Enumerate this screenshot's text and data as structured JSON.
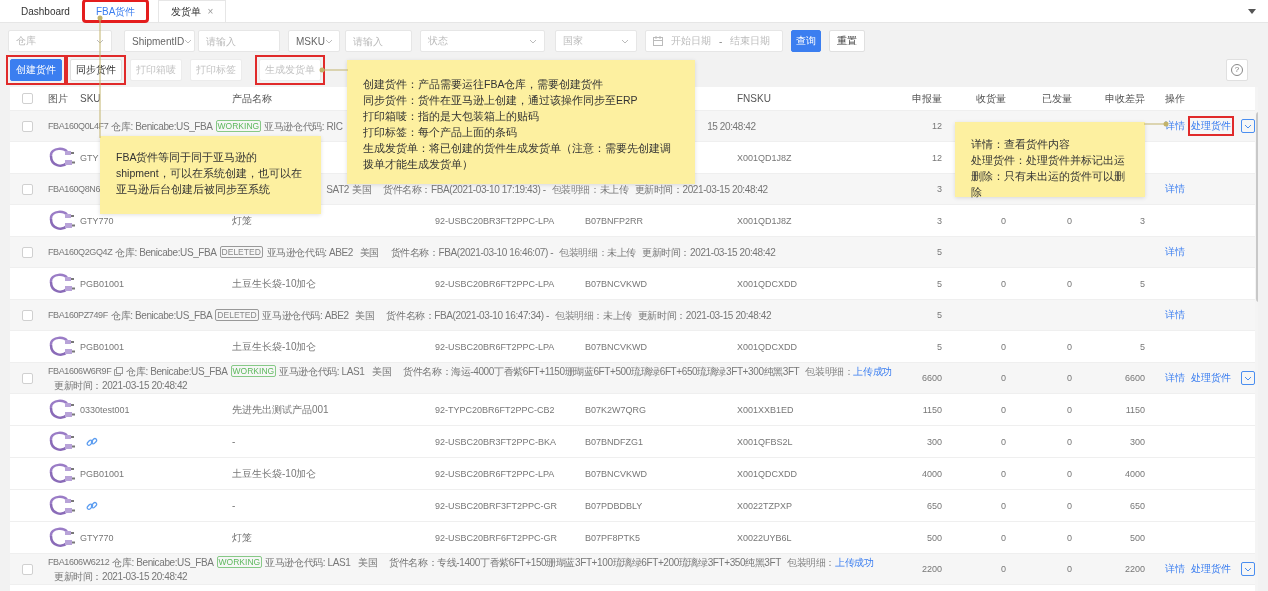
{
  "tabs": [
    {
      "label": "Dashboard",
      "selected": false,
      "highlighted": false
    },
    {
      "label": "FBA货件",
      "selected": true,
      "highlighted": true
    },
    {
      "label": "发货单",
      "selected": false,
      "highlighted": false,
      "close": "×"
    }
  ],
  "filters": [
    {
      "kind": "select",
      "placeholder": "仓库"
    },
    {
      "kind": "select",
      "value": "ShipmentID"
    },
    {
      "kind": "input",
      "placeholder": "请输入"
    },
    {
      "kind": "select",
      "value": "MSKU"
    },
    {
      "kind": "input",
      "placeholder": "请输入"
    },
    {
      "kind": "select",
      "placeholder": "状态"
    },
    {
      "kind": "select",
      "placeholder": "国家"
    },
    {
      "kind": "daterange",
      "start_placeholder": "开始日期",
      "separator": "-",
      "end_placeholder": "结束日期"
    },
    {
      "kind": "button",
      "label": "查询",
      "primary": true
    },
    {
      "kind": "button",
      "label": "重置",
      "primary": false
    }
  ],
  "toolbar": {
    "buttons": [
      {
        "label": "创建货件",
        "primary": true,
        "disabled": false,
        "highlighted": true
      },
      {
        "label": "同步货件",
        "primary": false,
        "disabled": false,
        "highlighted": true
      },
      {
        "label": "打印箱唛",
        "primary": false,
        "disabled": true,
        "highlighted": false
      },
      {
        "label": "打印标签",
        "primary": false,
        "disabled": true,
        "highlighted": false
      },
      {
        "label": "生成发货单",
        "primary": false,
        "disabled": true,
        "highlighted": true
      }
    ],
    "help": "?"
  },
  "table": {
    "select_all_checked": false,
    "columns": [
      "图片",
      "SKU",
      "产品名称",
      null,
      null,
      "FNSKU",
      "申报量",
      "收货量",
      "已发量",
      "申收差异",
      "操作"
    ],
    "rows": [
      {
        "kind": "shipment",
        "checked": false,
        "id": "FBA160Q0L4F7",
        "copy_icon": false,
        "warehouse": "仓库: Benicabe:US_FBA",
        "status": {
          "label": "WORKING",
          "kind": "working"
        },
        "code": "亚马逊仓代码: RIC",
        "fragment": "15 20:48:42",
        "declared": "12",
        "actions": [
          {
            "kind": "link",
            "label": "详情",
            "highlighted": false
          },
          {
            "kind": "link",
            "label": "处理货件",
            "highlighted": true
          },
          {
            "kind": "dropdown",
            "highlighted": false
          }
        ]
      },
      {
        "kind": "item",
        "sku": "GTY",
        "has_link": false,
        "fnsku": "X001QD1J8Z",
        "declared": "12"
      },
      {
        "kind": "shipment",
        "checked": false,
        "id": "FBA160Q8N6",
        "copy_icon": false,
        "code": "SAT2",
        "country": "美国",
        "name": "货件名称：FBA(2021-03-10 17:19:43) -",
        "pack": {
          "label": "包装明细：",
          "value": "未上传",
          "link": false
        },
        "updated": "更新时间：2021-03-15 20:48:42",
        "declared": "3",
        "actions": [
          {
            "kind": "link",
            "label": "详情",
            "highlighted": false
          }
        ]
      },
      {
        "kind": "item",
        "sku": "GTY770",
        "has_link": false,
        "product_name": "灯笼",
        "column_4": "92-USBC20BR3FT2PPC-LPA",
        "column_5": "B07BNFP2RR",
        "fnsku": "X001QD1J8Z",
        "declared": "3",
        "received": "0",
        "shipped": "0",
        "difference": "3"
      },
      {
        "kind": "shipment",
        "checked": false,
        "id": "FBA160Q2GQ4Z",
        "copy_icon": false,
        "warehouse": "仓库: Benicabe:US_FBA",
        "status": {
          "label": "DELETED",
          "kind": "deleted"
        },
        "code": "亚马逊仓代码: ABE2",
        "country": "美国",
        "name": "货件名称：FBA(2021-03-10 16:46:07) -",
        "pack": {
          "label": "包装明细：",
          "value": "未上传",
          "link": false
        },
        "updated": "更新时间：2021-03-15 20:48:42",
        "declared": "5",
        "actions": [
          {
            "kind": "link",
            "label": "详情",
            "highlighted": false
          }
        ]
      },
      {
        "kind": "item",
        "sku": "PGB01001",
        "has_link": false,
        "product_name": "土豆生长袋-10加仑",
        "column_4": "92-USBC20BR6FT2PPC-LPA",
        "column_5": "B07BNCVKWD",
        "fnsku": "X001QDCXDD",
        "declared": "5",
        "received": "0",
        "shipped": "0",
        "difference": "5"
      },
      {
        "kind": "shipment",
        "checked": false,
        "id": "FBA160PZ749F",
        "copy_icon": false,
        "warehouse": "仓库: Benicabe:US_FBA",
        "status": {
          "label": "DELETED",
          "kind": "deleted"
        },
        "code": "亚马逊仓代码: ABE2",
        "country": "美国",
        "name": "货件名称：FBA(2021-03-10 16:47:34) -",
        "pack": {
          "label": "包装明细：",
          "value": "未上传",
          "link": false
        },
        "updated": "更新时间：2021-03-15 20:48:42",
        "declared": "5",
        "actions": [
          {
            "kind": "link",
            "label": "详情",
            "highlighted": false
          }
        ]
      },
      {
        "kind": "item",
        "sku": "PGB01001",
        "has_link": false,
        "product_name": "土豆生长袋-10加仑",
        "column_4": "92-USBC20BR6FT2PPC-LPA",
        "column_5": "B07BNCVKWD",
        "fnsku": "X001QDCXDD",
        "declared": "5",
        "received": "0",
        "shipped": "0",
        "difference": "5"
      },
      {
        "kind": "shipment",
        "checked": false,
        "id": "FBA1606W6R9F",
        "copy_icon": true,
        "warehouse": "仓库: Benicabe:US_FBA",
        "status": {
          "label": "WORKING",
          "kind": "working"
        },
        "code": "亚马逊仓代码: LAS1",
        "country": "美国",
        "name": "货件名称：海运-4000丁香紫6FT+1150珊瑚蓝6FT+500琉璃绿6FT+650琉璃绿3FT+300纯黑3FT",
        "pack": {
          "label": "包装明细：",
          "value": "上传成功",
          "link": true
        },
        "updated": "更新时间：2021-03-15 20:48:42",
        "declared": "6600",
        "received": "0",
        "shipped": "0",
        "difference": "6600",
        "actions": [
          {
            "kind": "link",
            "label": "详情",
            "highlighted": false
          },
          {
            "kind": "link",
            "label": "处理货件",
            "highlighted": false
          },
          {
            "kind": "dropdown",
            "highlighted": false
          }
        ]
      },
      {
        "kind": "item",
        "sku": "0330test001",
        "has_link": false,
        "product_name": "先进先出测试产品001",
        "column_4": "92-TYPC20BR6FT2PPC-CB2",
        "column_5": "B07K2W7QRG",
        "fnsku": "X001XXB1ED",
        "declared": "1150",
        "received": "0",
        "shipped": "0",
        "difference": "1150"
      },
      {
        "kind": "item",
        "has_link": true,
        "product_name": "-",
        "column_4": "92-USBC20BR3FT2PPC-BKA",
        "column_5": "B07BNDFZG1",
        "fnsku": "X001QFBS2L",
        "declared": "300",
        "received": "0",
        "shipped": "0",
        "difference": "300"
      },
      {
        "kind": "item",
        "sku": "PGB01001",
        "has_link": false,
        "product_name": "土豆生长袋-10加仑",
        "column_4": "92-USBC20BR6FT2PPC-LPA",
        "column_5": "B07BNCVKWD",
        "fnsku": "X001QDCXDD",
        "declared": "4000",
        "received": "0",
        "shipped": "0",
        "difference": "4000"
      },
      {
        "kind": "item",
        "has_link": true,
        "product_name": "-",
        "column_4": "92-USBC20BRF3FT2PPC-GR",
        "column_5": "B07PDBDBLY",
        "fnsku": "X0022TZPXP",
        "declared": "650",
        "received": "0",
        "shipped": "0",
        "difference": "650"
      },
      {
        "kind": "item",
        "sku": "GTY770",
        "has_link": false,
        "product_name": "灯笼",
        "column_4": "92-USBC20BRF6FT2PPC-GR",
        "column_5": "B07PF8PTK5",
        "fnsku": "X0022UYB6L",
        "declared": "500",
        "received": "0",
        "shipped": "0",
        "difference": "500"
      },
      {
        "kind": "shipment",
        "checked": false,
        "id": "FBA1606W6212",
        "copy_icon": false,
        "warehouse": "仓库: Benicabe:US_FBA",
        "status": {
          "label": "WORKING",
          "kind": "working"
        },
        "code": "亚马逊仓代码: LAS1",
        "country": "美国",
        "name": "货件名称：专线-1400丁香紫6FT+150珊瑚蓝3FT+100琉璃绿6FT+200琉璃绿3FT+350纯黑3FT",
        "pack": {
          "label": "包装明细：",
          "value": "上传成功",
          "link": true
        },
        "updated": "更新时间：2021-03-15 20:48:42",
        "declared": "2200",
        "received": "0",
        "shipped": "0",
        "difference": "2200",
        "actions": [
          {
            "kind": "link",
            "label": "详情",
            "highlighted": false
          },
          {
            "kind": "link",
            "label": "处理货件",
            "highlighted": false
          },
          {
            "kind": "dropdown",
            "highlighted": false
          }
        ]
      }
    ]
  },
  "notes": [
    {
      "lines": [
        "FBA货件等同于同于亚马逊的shipment，可以在系统创建，也可以在亚马逊后台创建后被同步至系统"
      ]
    },
    {
      "lines": [
        "创建货件：产品需要运往FBA仓库，需要创建货件",
        "同步货件：货件在亚马逊上创建，通过该操作同步至ERP",
        "打印箱唛：指的是大包装箱上的贴码",
        "打印标签：每个产品上面的条码",
        "生成发货单：将已创建的货件生成发货单（注意：需要先创建调拨单才能生成发货单）"
      ]
    },
    {
      "lines": [
        "详情：查看货件内容",
        "处理货件：处理货件并标记出运",
        "删除：只有未出运的货件可以删除"
      ]
    }
  ]
}
